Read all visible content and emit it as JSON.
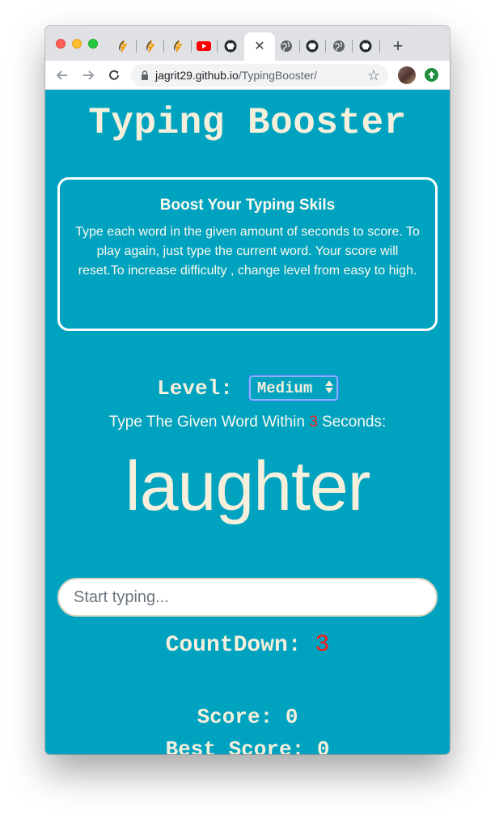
{
  "browser": {
    "tabs": [
      {
        "icon": "blogger-logo-icon",
        "active": false
      },
      {
        "icon": "blogger-logo-icon",
        "active": false
      },
      {
        "icon": "blogger-logo-icon",
        "active": false
      },
      {
        "icon": "youtube-icon",
        "active": false
      },
      {
        "icon": "github-icon",
        "active": false
      },
      {
        "icon": "close-icon",
        "active": true
      },
      {
        "icon": "globe-icon",
        "active": false
      },
      {
        "icon": "github-icon",
        "active": false
      },
      {
        "icon": "globe-icon",
        "active": false
      },
      {
        "icon": "github-icon",
        "active": false
      }
    ],
    "new_tab_label": "+",
    "active_tab_close": "✕",
    "url_host": "jagrit29.github.io",
    "url_path": "/TypingBooster/",
    "bookmark_glyph": "☆"
  },
  "page": {
    "title": "Typing Booster",
    "info": {
      "heading": "Boost Your Typing Skils",
      "text": "Type each word in the given amount of seconds to score. To play again, just type the current word. Your score will reset.To increase difficulty , change level from easy to high."
    },
    "level": {
      "label": "Level:",
      "selected": "Medium"
    },
    "instruction": {
      "prefix": "Type The Given Word Within ",
      "seconds": "3",
      "suffix": " Seconds:"
    },
    "current_word": "laughter",
    "input": {
      "value": "",
      "placeholder": "Start typing..."
    },
    "countdown": {
      "label": "CountDown:",
      "value": "3"
    },
    "score": {
      "label": "Score:",
      "value": "0"
    },
    "best_score": {
      "label": "Best Score:",
      "value": "0"
    }
  },
  "colors": {
    "page_background": "#00a3bf",
    "text_cream": "#f5efdc",
    "accent_red": "#ff1a1a"
  }
}
